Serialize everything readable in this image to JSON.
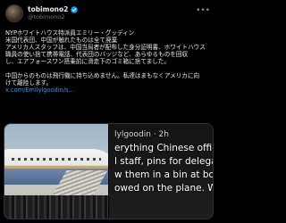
{
  "post": {
    "display_name": "tobimono2",
    "handle": "@tobimono2",
    "verified_badge": "check-badge-icon",
    "more_icon": "ellipsis-icon",
    "lines": [
      "NYPホワイトハウス特派員エミリー・グッディン",
      "米国代表団、中国が触れたものは全て廃棄",
      "アメリカ人スタッフは、中国当局者が配布した身分証明書、ホワイトハウス",
      "職員の使い捨て携帯電話、代表団のバッジなど、あらゆるものを回収",
      "し、エアフォースワン搭乗前に滑走下のゴミ箱に捨てました。",
      "",
      "中国からのものは飛行機に持ち込めません。私達はまもなくアメリカに向",
      "けて離陸します。"
    ],
    "link_text": "x.com/Emilylgoodin/s..."
  },
  "media": {
    "left_photo": "photo-air-force-one",
    "right_caption_handle": "lylgoodin · 2h",
    "right_caption_lines": [
      "erything Chinese officia",
      "l staff, pins for delegat",
      "w them in a bin at bott",
      "owed on the plane. We'"
    ]
  },
  "colors": {
    "background": "#000000",
    "text": "#e7e9ea",
    "secondary": "#71767b",
    "link": "#1d9bf0",
    "verified": "#1d9bf0"
  }
}
